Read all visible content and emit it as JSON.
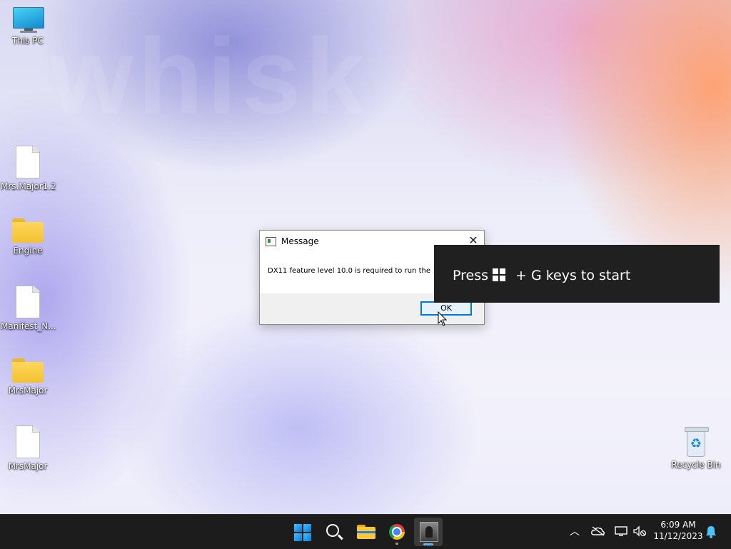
{
  "desktop": {
    "icons": [
      {
        "label": "This PC",
        "type": "this-pc"
      },
      {
        "label": "Mrs.Major1.2",
        "type": "file"
      },
      {
        "label": "Engine",
        "type": "folder"
      },
      {
        "label": "Manifest_N...",
        "type": "file"
      },
      {
        "label": "MrsMajor",
        "type": "folder"
      },
      {
        "label": "MrsMajor",
        "type": "file"
      },
      {
        "label": "Recycle Bin",
        "type": "recycle-bin"
      }
    ]
  },
  "dialog": {
    "title": "Message",
    "message": "DX11 feature level 10.0 is required to run the",
    "ok_label": "OK",
    "close_glyph": "✕"
  },
  "gamebar_toast": {
    "text_before": "Press",
    "text_after": "+ G keys to start"
  },
  "taskbar": {
    "apps": [
      "start",
      "search",
      "file-explorer",
      "chrome",
      "game"
    ],
    "active_app": "game",
    "tray": {
      "overflow_glyph": "︿",
      "time": "6:09 AM",
      "date": "11/12/2023"
    }
  },
  "colors": {
    "accent": "#0078d7",
    "taskbar": "#1c1c1c",
    "toast_bg": "#202020"
  }
}
